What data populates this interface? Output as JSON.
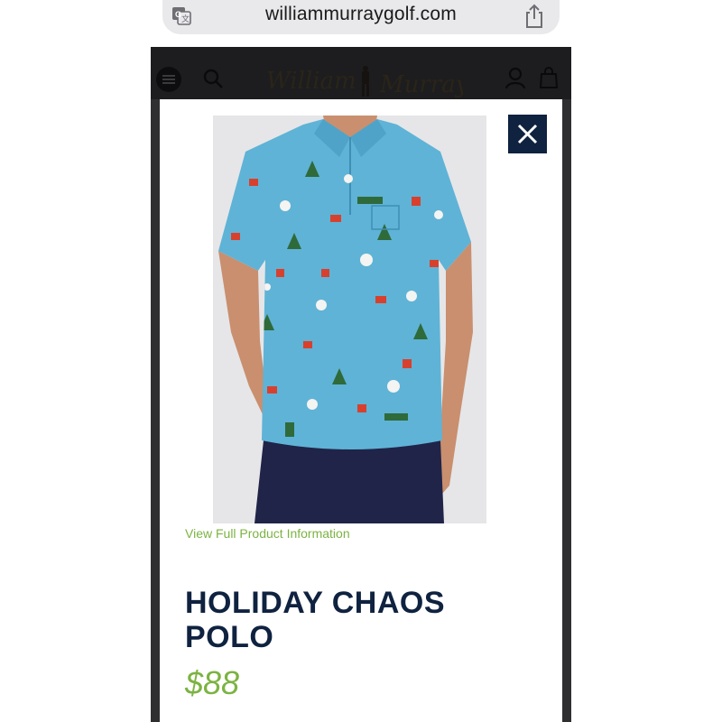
{
  "browser": {
    "url": "williammurraygolf.com"
  },
  "header": {
    "logo_alt": "William Murray"
  },
  "modal": {
    "view_full_link": "View Full Product Information",
    "title": "HOLIDAY CHAOS POLO",
    "price": "$88"
  },
  "colors": {
    "navy": "#0f2240",
    "accent_green": "#7cb342",
    "shirt_blue": "#5fb3d6"
  }
}
